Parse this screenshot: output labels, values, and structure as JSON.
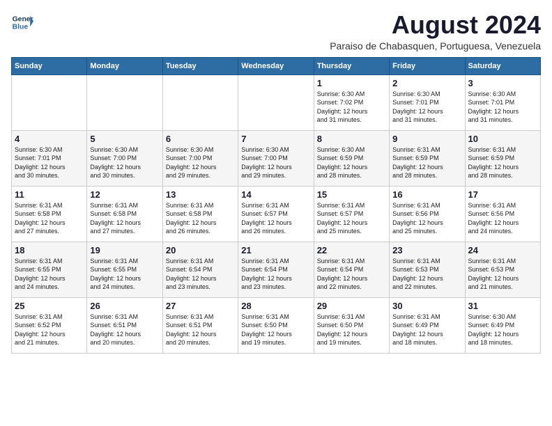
{
  "logo": {
    "line1": "General",
    "line2": "Blue"
  },
  "title": "August 2024",
  "subtitle": "Paraiso de Chabasquen, Portuguesa, Venezuela",
  "weekdays": [
    "Sunday",
    "Monday",
    "Tuesday",
    "Wednesday",
    "Thursday",
    "Friday",
    "Saturday"
  ],
  "weeks": [
    [
      {
        "day": "",
        "info": ""
      },
      {
        "day": "",
        "info": ""
      },
      {
        "day": "",
        "info": ""
      },
      {
        "day": "",
        "info": ""
      },
      {
        "day": "1",
        "info": "Sunrise: 6:30 AM\nSunset: 7:02 PM\nDaylight: 12 hours\nand 31 minutes."
      },
      {
        "day": "2",
        "info": "Sunrise: 6:30 AM\nSunset: 7:01 PM\nDaylight: 12 hours\nand 31 minutes."
      },
      {
        "day": "3",
        "info": "Sunrise: 6:30 AM\nSunset: 7:01 PM\nDaylight: 12 hours\nand 31 minutes."
      }
    ],
    [
      {
        "day": "4",
        "info": "Sunrise: 6:30 AM\nSunset: 7:01 PM\nDaylight: 12 hours\nand 30 minutes."
      },
      {
        "day": "5",
        "info": "Sunrise: 6:30 AM\nSunset: 7:00 PM\nDaylight: 12 hours\nand 30 minutes."
      },
      {
        "day": "6",
        "info": "Sunrise: 6:30 AM\nSunset: 7:00 PM\nDaylight: 12 hours\nand 29 minutes."
      },
      {
        "day": "7",
        "info": "Sunrise: 6:30 AM\nSunset: 7:00 PM\nDaylight: 12 hours\nand 29 minutes."
      },
      {
        "day": "8",
        "info": "Sunrise: 6:30 AM\nSunset: 6:59 PM\nDaylight: 12 hours\nand 28 minutes."
      },
      {
        "day": "9",
        "info": "Sunrise: 6:31 AM\nSunset: 6:59 PM\nDaylight: 12 hours\nand 28 minutes."
      },
      {
        "day": "10",
        "info": "Sunrise: 6:31 AM\nSunset: 6:59 PM\nDaylight: 12 hours\nand 28 minutes."
      }
    ],
    [
      {
        "day": "11",
        "info": "Sunrise: 6:31 AM\nSunset: 6:58 PM\nDaylight: 12 hours\nand 27 minutes."
      },
      {
        "day": "12",
        "info": "Sunrise: 6:31 AM\nSunset: 6:58 PM\nDaylight: 12 hours\nand 27 minutes."
      },
      {
        "day": "13",
        "info": "Sunrise: 6:31 AM\nSunset: 6:58 PM\nDaylight: 12 hours\nand 26 minutes."
      },
      {
        "day": "14",
        "info": "Sunrise: 6:31 AM\nSunset: 6:57 PM\nDaylight: 12 hours\nand 26 minutes."
      },
      {
        "day": "15",
        "info": "Sunrise: 6:31 AM\nSunset: 6:57 PM\nDaylight: 12 hours\nand 25 minutes."
      },
      {
        "day": "16",
        "info": "Sunrise: 6:31 AM\nSunset: 6:56 PM\nDaylight: 12 hours\nand 25 minutes."
      },
      {
        "day": "17",
        "info": "Sunrise: 6:31 AM\nSunset: 6:56 PM\nDaylight: 12 hours\nand 24 minutes."
      }
    ],
    [
      {
        "day": "18",
        "info": "Sunrise: 6:31 AM\nSunset: 6:55 PM\nDaylight: 12 hours\nand 24 minutes."
      },
      {
        "day": "19",
        "info": "Sunrise: 6:31 AM\nSunset: 6:55 PM\nDaylight: 12 hours\nand 24 minutes."
      },
      {
        "day": "20",
        "info": "Sunrise: 6:31 AM\nSunset: 6:54 PM\nDaylight: 12 hours\nand 23 minutes."
      },
      {
        "day": "21",
        "info": "Sunrise: 6:31 AM\nSunset: 6:54 PM\nDaylight: 12 hours\nand 23 minutes."
      },
      {
        "day": "22",
        "info": "Sunrise: 6:31 AM\nSunset: 6:54 PM\nDaylight: 12 hours\nand 22 minutes."
      },
      {
        "day": "23",
        "info": "Sunrise: 6:31 AM\nSunset: 6:53 PM\nDaylight: 12 hours\nand 22 minutes."
      },
      {
        "day": "24",
        "info": "Sunrise: 6:31 AM\nSunset: 6:53 PM\nDaylight: 12 hours\nand 21 minutes."
      }
    ],
    [
      {
        "day": "25",
        "info": "Sunrise: 6:31 AM\nSunset: 6:52 PM\nDaylight: 12 hours\nand 21 minutes."
      },
      {
        "day": "26",
        "info": "Sunrise: 6:31 AM\nSunset: 6:51 PM\nDaylight: 12 hours\nand 20 minutes."
      },
      {
        "day": "27",
        "info": "Sunrise: 6:31 AM\nSunset: 6:51 PM\nDaylight: 12 hours\nand 20 minutes."
      },
      {
        "day": "28",
        "info": "Sunrise: 6:31 AM\nSunset: 6:50 PM\nDaylight: 12 hours\nand 19 minutes."
      },
      {
        "day": "29",
        "info": "Sunrise: 6:31 AM\nSunset: 6:50 PM\nDaylight: 12 hours\nand 19 minutes."
      },
      {
        "day": "30",
        "info": "Sunrise: 6:31 AM\nSunset: 6:49 PM\nDaylight: 12 hours\nand 18 minutes."
      },
      {
        "day": "31",
        "info": "Sunrise: 6:30 AM\nSunset: 6:49 PM\nDaylight: 12 hours\nand 18 minutes."
      }
    ]
  ]
}
